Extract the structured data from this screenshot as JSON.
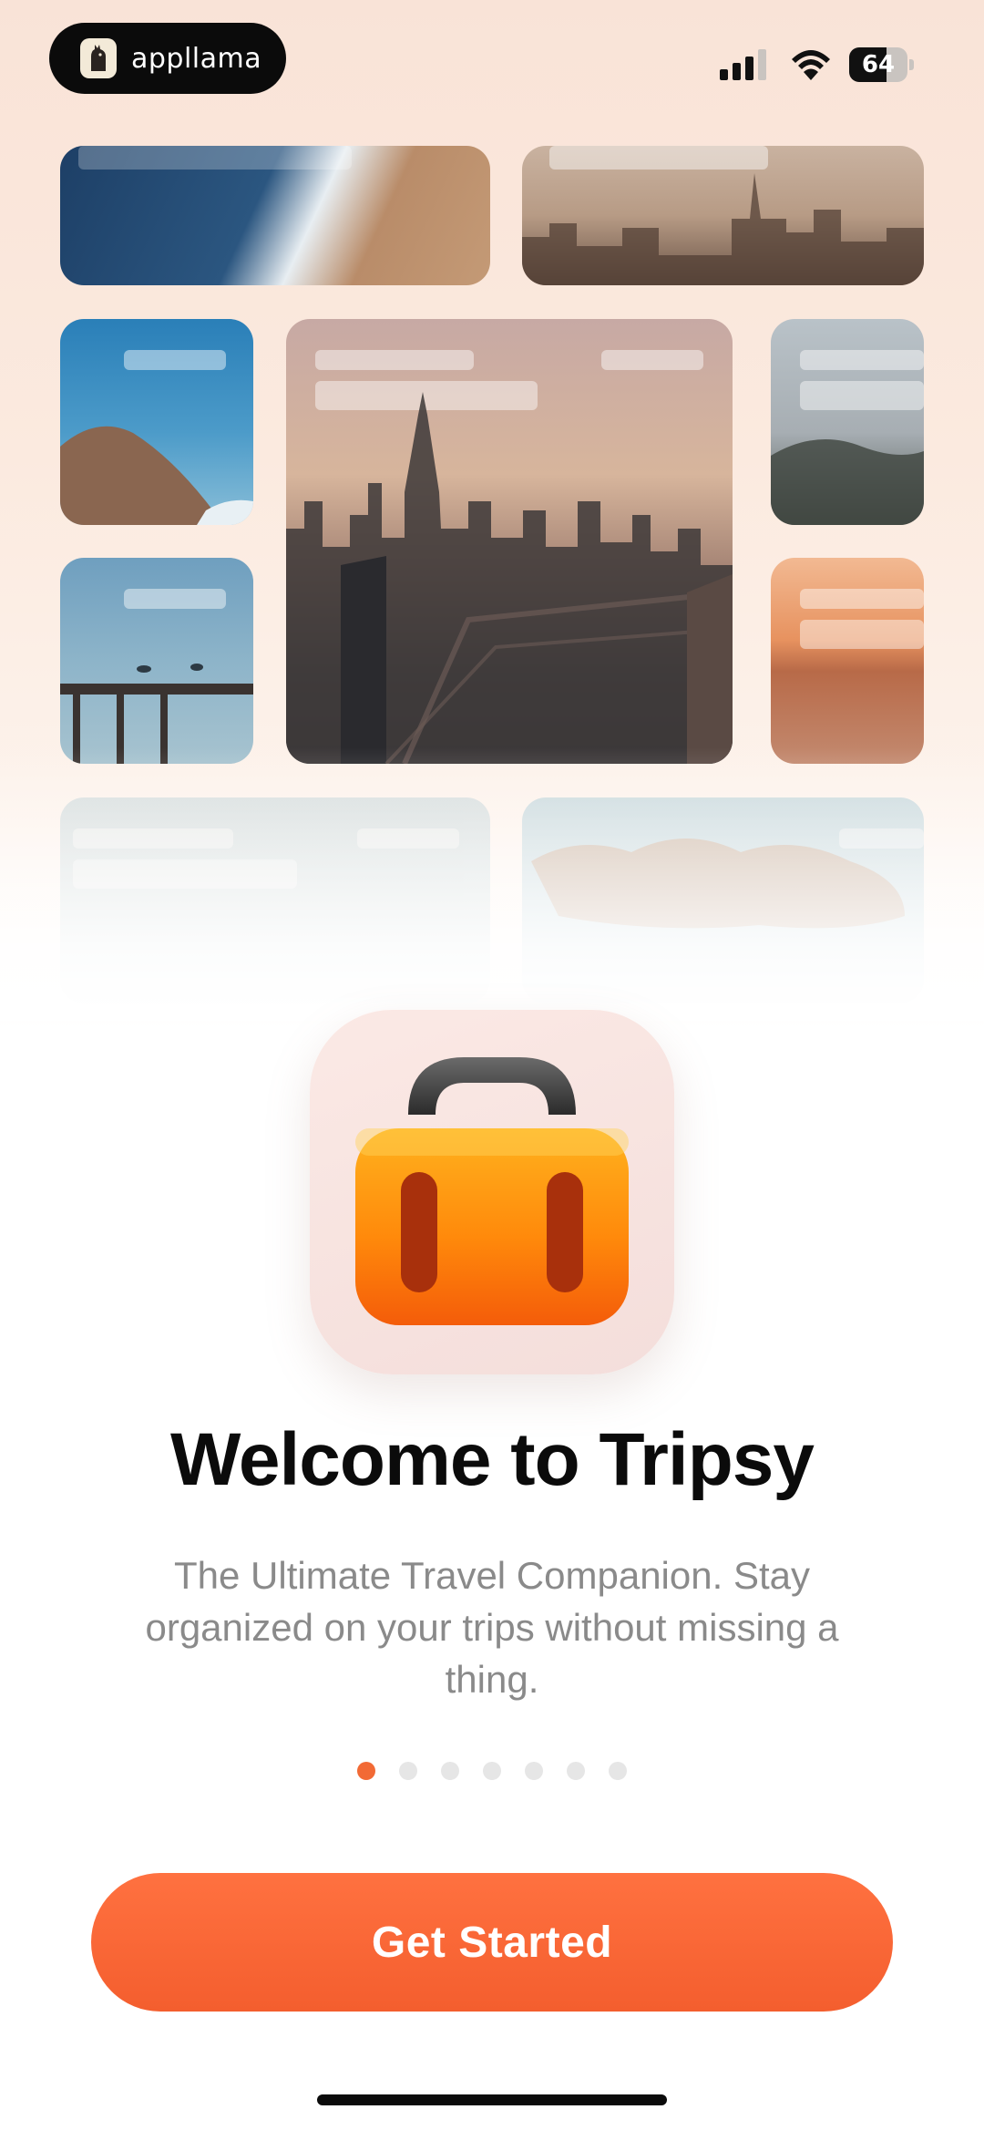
{
  "status_bar": {
    "brand_name": "appllama",
    "battery_level": "64",
    "battery_percent": 64
  },
  "hero": {
    "title": "Welcome to Tripsy",
    "subtitle": "The Ultimate Travel Companion. Stay organized on your trips without missing a thing."
  },
  "pager": {
    "total_pages": 7,
    "current_page": 1
  },
  "cta": {
    "label": "Get Started"
  },
  "colors": {
    "accent": "#f26a35",
    "title_text": "#0b0b0b",
    "subtitle_text": "#8a8a8a"
  },
  "icons": [
    "signal-icon",
    "wifi-icon",
    "battery-icon",
    "suitcase-icon",
    "llama-logo-icon"
  ]
}
